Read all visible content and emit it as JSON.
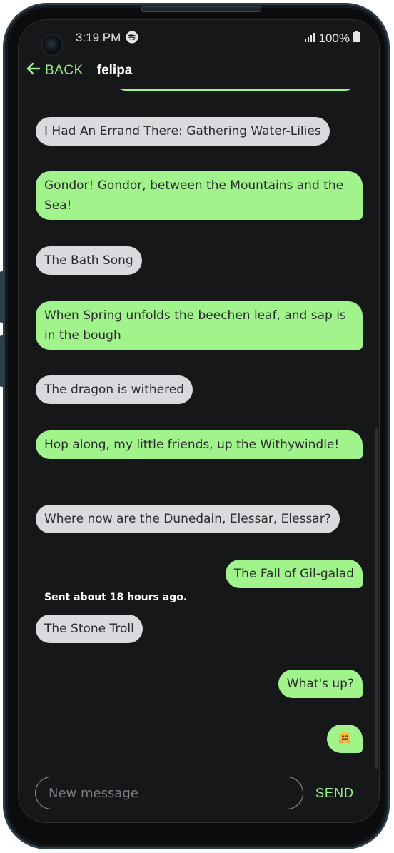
{
  "status_bar": {
    "time": "3:19 PM",
    "battery": "100%",
    "icons": [
      "spotify-icon",
      "signal-icon",
      "battery-icon"
    ]
  },
  "header": {
    "back_label": "BACK",
    "title": "felipa"
  },
  "messages": [
    {
      "direction": "incoming",
      "text": "I Had An Errand There: Gathering Water-Lilies"
    },
    {
      "direction": "outgoing",
      "text": "Gondor! Gondor, between the Mountains and the Sea!"
    },
    {
      "direction": "incoming",
      "text": "The Bath Song"
    },
    {
      "direction": "outgoing",
      "text": "When Spring unfolds the beechen leaf, and sap is in the bough"
    },
    {
      "direction": "incoming",
      "text": "The dragon is withered"
    },
    {
      "direction": "outgoing",
      "text": "Hop along, my little friends, up the Withywindle!"
    },
    {
      "direction": "incoming",
      "text": "Where now are the Dunedain, Elessar, Elessar?"
    },
    {
      "direction": "outgoing",
      "text": "The Fall of Gil-galad"
    },
    {
      "direction": "incoming",
      "text": "The Stone Troll",
      "meta": "Sent about 18 hours ago."
    },
    {
      "direction": "outgoing",
      "text": "What's up?"
    },
    {
      "direction": "outgoing",
      "emoji": "hugging-face-emoji"
    }
  ],
  "composer": {
    "placeholder": "New message",
    "value": "",
    "send_label": "SEND"
  },
  "colors": {
    "accent": "#9cf08a",
    "outgoing_bubble": "#a1f48c",
    "incoming_bubble": "#d9d9de",
    "background": "#151719"
  }
}
